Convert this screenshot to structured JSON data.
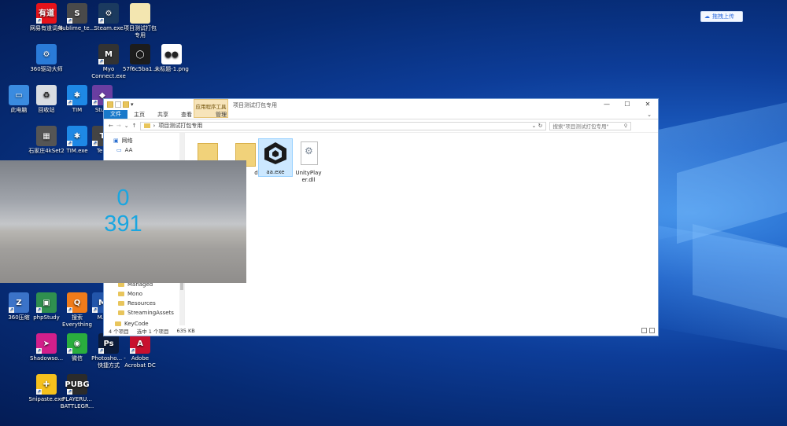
{
  "desktop": {
    "icons": [
      {
        "name": "youdao",
        "label": "网易有道词典",
        "color": "#e8131a",
        "glyph": "有道",
        "shortcut": true
      },
      {
        "name": "sublime",
        "label": "sublime_te...",
        "color": "#4a4a4a",
        "glyph": "S",
        "shortcut": true
      },
      {
        "name": "steam",
        "label": "Steam.exe",
        "color": "#1b3a5f",
        "glyph": "⚙",
        "shortcut": true
      },
      {
        "name": "pkg-folder",
        "label": "项目测试打包专用",
        "color": "#f3e6b0",
        "glyph": "",
        "shortcut": false
      },
      {
        "name": "driver",
        "label": "360驱动大师",
        "color": "#2a7bd8",
        "glyph": "⚙",
        "shortcut": false
      },
      {
        "name": "myo",
        "label": "Myo Connect.exe",
        "color": "#333333",
        "glyph": "M",
        "shortcut": true
      },
      {
        "name": "img-57",
        "label": "57f6c5ba1...",
        "color": "#1c1c1c",
        "glyph": "◯",
        "shortcut": false
      },
      {
        "name": "untitled-png",
        "label": "未标题-1.png",
        "color": "#ffffff",
        "glyph": "●●",
        "shortcut": false
      },
      {
        "name": "this-pc",
        "label": "此电脑",
        "color": "#3a8be0",
        "glyph": "▭",
        "shortcut": false
      },
      {
        "name": "recycle-bin",
        "label": "回收站",
        "color": "#d9dde2",
        "glyph": "♻",
        "shortcut": false
      },
      {
        "name": "tim1",
        "label": "TIM",
        "color": "#1e88e5",
        "glyph": "✱",
        "shortcut": true
      },
      {
        "name": "vs-studio",
        "label": "Stu...",
        "color": "#6a3ea1",
        "glyph": "◆",
        "shortcut": true
      },
      {
        "name": "shijiazhuang",
        "label": "石家庄4kSet2",
        "color": "#555555",
        "glyph": "▦",
        "shortcut": false
      },
      {
        "name": "tim2",
        "label": "TIM.exe",
        "color": "#1e88e5",
        "glyph": "✱",
        "shortcut": true
      },
      {
        "name": "te",
        "label": "Te...",
        "color": "#444444",
        "glyph": "T",
        "shortcut": true
      },
      {
        "name": "compress360",
        "label": "360压缩",
        "color": "#3b73c8",
        "glyph": "Z",
        "shortcut": true
      },
      {
        "name": "phpstudy",
        "label": "phpStudy",
        "color": "#2f8f4f",
        "glyph": "▣",
        "shortcut": true
      },
      {
        "name": "everything",
        "label": "搜索Everything",
        "color": "#f07b1a",
        "glyph": "Q",
        "shortcut": true
      },
      {
        "name": "m-app",
        "label": "M...",
        "color": "#2255aa",
        "glyph": "M",
        "shortcut": true
      },
      {
        "name": "shadowsocks",
        "label": "Shadowso...",
        "color": "#d21f8b",
        "glyph": "➤",
        "shortcut": true
      },
      {
        "name": "wechat",
        "label": "微信",
        "color": "#2aae3e",
        "glyph": "◉",
        "shortcut": true
      },
      {
        "name": "photoshop",
        "label": "Photosho... - 快捷方式",
        "color": "#0b1b3a",
        "glyph": "Ps",
        "shortcut": true
      },
      {
        "name": "acrobat",
        "label": "Adobe Acrobat DC",
        "color": "#c8102e",
        "glyph": "A",
        "shortcut": true
      },
      {
        "name": "snipaste",
        "label": "Snipaste.exe",
        "color": "#f6c11d",
        "glyph": "✚",
        "shortcut": true
      },
      {
        "name": "pubg",
        "label": "PLAYERU... BATTLEGR...",
        "color": "#2b2b2b",
        "glyph": "PUBG",
        "shortcut": true
      }
    ],
    "upload_button": "拖拽上传"
  },
  "explorer": {
    "context_tab": "应用程序工具",
    "window_title": "项目测试打包专用",
    "controls": {
      "minimize": "—",
      "maximize": "☐",
      "close": "✕"
    },
    "ribbon_tabs": [
      "文件",
      "主页",
      "共享",
      "查看",
      "管理"
    ],
    "ribbon_caret": "⌄",
    "nav_buttons": {
      "back": "←",
      "forward": "→",
      "recent": "⌄",
      "up": "↑"
    },
    "address_path": "项目测试打包专用",
    "search_placeholder": "搜索\"项目测试打包专用\"",
    "nav_pane": {
      "top_items": [
        "网络",
        "AA"
      ],
      "folders": [
        "Managed",
        "Mono",
        "Resources",
        "StreamingAssets"
      ],
      "bottom_item": "KeyCode"
    },
    "files": [
      {
        "name": "",
        "type": "folder"
      },
      {
        "name": "de",
        "type": "folder"
      },
      {
        "name": "aa.exe",
        "type": "unity-exe"
      },
      {
        "name": "UnityPlayer.dll",
        "type": "dll"
      }
    ],
    "status": {
      "count": "4 个项目",
      "selected": "选中 1 个项目",
      "size": "635 KB"
    }
  },
  "game_window": {
    "values": [
      "0",
      "391"
    ],
    "value_color": "#1aa6e0"
  }
}
